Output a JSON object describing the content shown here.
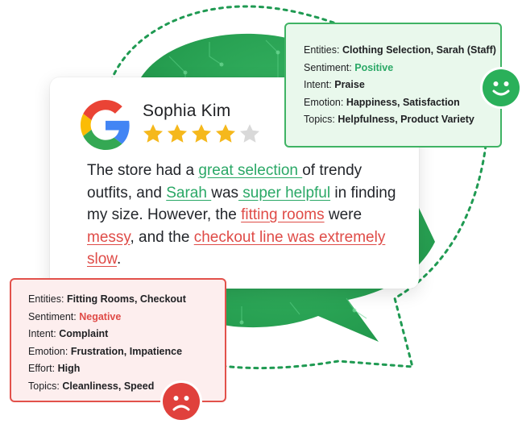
{
  "reviewer": {
    "name": "Sophia Kim",
    "logo_icon": "google-logo-icon",
    "rating": 4,
    "rating_max": 5
  },
  "review": {
    "segments": [
      {
        "text": "The store had a ",
        "type": "plain"
      },
      {
        "text": "great selection ",
        "type": "positive"
      },
      {
        "text": "of trendy outfits, and ",
        "type": "plain"
      },
      {
        "text": "Sarah ",
        "type": "positive"
      },
      {
        "text": "was",
        "type": "plain"
      },
      {
        "text": " super helpful",
        "type": "positive"
      },
      {
        "text": " in finding my size. However, the ",
        "type": "plain"
      },
      {
        "text": "fitting rooms",
        "type": "negative"
      },
      {
        "text": " were ",
        "type": "plain"
      },
      {
        "text": "messy",
        "type": "negative"
      },
      {
        "text": ", and the ",
        "type": "plain"
      },
      {
        "text": "checkout line was extremely slow",
        "type": "negative"
      },
      {
        "text": ".",
        "type": "plain"
      }
    ]
  },
  "positive_analysis": {
    "rows": [
      {
        "label": "Entities: ",
        "value": "Clothing Selection, Sarah (Staff)"
      },
      {
        "label": "Sentiment: ",
        "value": "Positive"
      },
      {
        "label": "Intent: ",
        "value": "Praise"
      },
      {
        "label": "Emotion: ",
        "value": "Happiness, Satisfaction"
      },
      {
        "label": "Topics: ",
        "value": "Helpfulness, Product Variety"
      }
    ],
    "icon": "smiley-face-icon"
  },
  "negative_analysis": {
    "rows": [
      {
        "label": "Entities: ",
        "value": "Fitting Rooms, Checkout"
      },
      {
        "label": "Sentiment: ",
        "value": "Negative"
      },
      {
        "label": "Intent: ",
        "value": "Complaint"
      },
      {
        "label": "Emotion: ",
        "value": "Frustration, Impatience"
      },
      {
        "label": "Effort: ",
        "value": "High"
      },
      {
        "label": "Topics: ",
        "value": "Cleanliness, Speed"
      }
    ],
    "icon": "sad-face-icon"
  },
  "colors": {
    "positive": "#2aa866",
    "negative": "#df4b47",
    "star_filled": "#f5b81c",
    "star_empty": "#d9d9d9",
    "bubble_green": "#2fa85a"
  }
}
